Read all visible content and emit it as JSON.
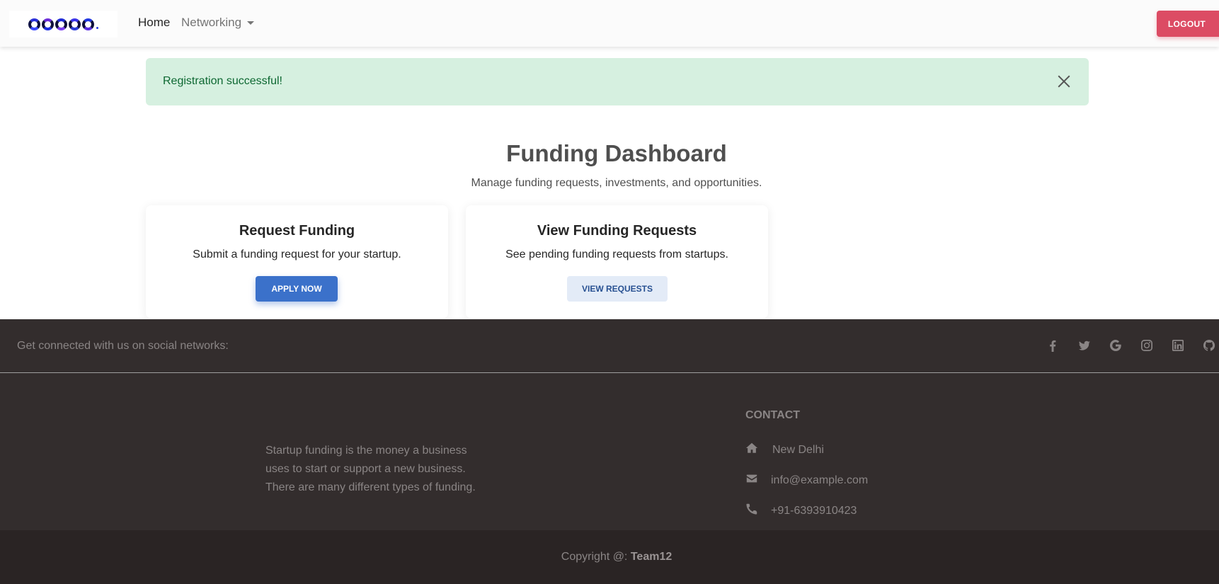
{
  "navbar": {
    "home_label": "Home",
    "networking_label": "Networking",
    "logout_label": "LOGOUT"
  },
  "alert": {
    "message": "Registration successful!"
  },
  "dashboard": {
    "title": "Funding Dashboard",
    "subtitle": "Manage funding requests, investments, and opportunities."
  },
  "cards": [
    {
      "title": "Request Funding",
      "text": "Submit a funding request for your startup.",
      "button": "APPLY NOW"
    },
    {
      "title": "View Funding Requests",
      "text": "See pending funding requests from startups.",
      "button": "VIEW REQUESTS"
    }
  ],
  "footer": {
    "social_text": "Get connected with us on social networks:",
    "social_icons": [
      "facebook-icon",
      "twitter-icon",
      "google-icon",
      "instagram-icon",
      "linkedin-icon",
      "github-icon"
    ],
    "about": "Startup funding is the money a business uses to start or support a new business. There are many different types of funding.",
    "contact_heading": "CONTACT",
    "address": "New Delhi",
    "email": "info@example.com",
    "phone": "+91-6393910423",
    "copyright_prefix": "Copyright @: ",
    "copyright_team": "Team12"
  },
  "colors": {
    "logout": "#dc4c64",
    "primary": "#3b71ca",
    "alert_bg": "#d6f0e0",
    "alert_text": "#0d6832",
    "footer_bg": "#332d2d"
  }
}
